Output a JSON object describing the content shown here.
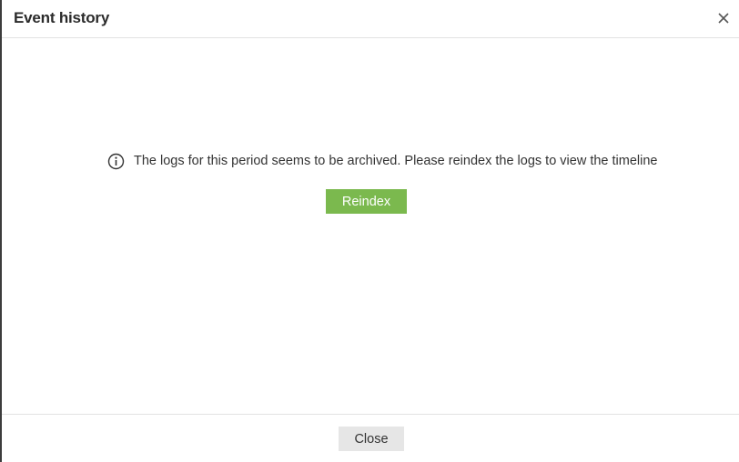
{
  "dialog": {
    "title": "Event history",
    "close_icon": "close-icon"
  },
  "body": {
    "info_icon": "info-icon",
    "message": "The logs for this period seems to be archived. Please reindex the logs to view the timeline",
    "reindex_label": "Reindex"
  },
  "footer": {
    "close_label": "Close"
  },
  "colors": {
    "reindex_button": "#7bb94e",
    "close_button": "#e6e6e6",
    "title_text": "#2b2b2b"
  }
}
